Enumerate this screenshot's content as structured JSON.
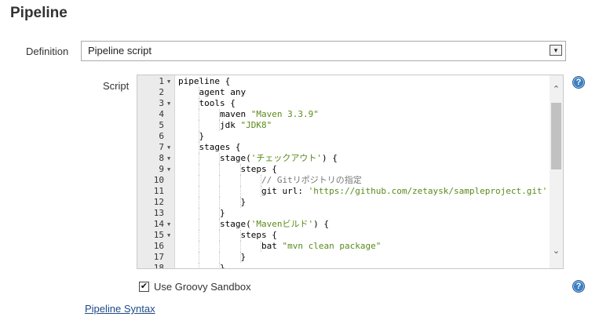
{
  "section": {
    "title": "Pipeline"
  },
  "definition": {
    "label": "Definition",
    "selected": "Pipeline script",
    "arrow": "▾"
  },
  "script": {
    "label": "Script",
    "lines": [
      {
        "n": "1",
        "fold": true,
        "indent": 0,
        "parts": [
          {
            "t": "pipeline {",
            "c": "kw"
          }
        ]
      },
      {
        "n": "2",
        "fold": false,
        "indent": 1,
        "parts": [
          {
            "t": "agent any",
            "c": "kw"
          }
        ]
      },
      {
        "n": "3",
        "fold": true,
        "indent": 1,
        "parts": [
          {
            "t": "tools {",
            "c": "kw"
          }
        ]
      },
      {
        "n": "4",
        "fold": false,
        "indent": 2,
        "parts": [
          {
            "t": "maven ",
            "c": "kw"
          },
          {
            "t": "\"Maven 3.3.9\"",
            "c": "str"
          }
        ]
      },
      {
        "n": "5",
        "fold": false,
        "indent": 2,
        "parts": [
          {
            "t": "jdk ",
            "c": "kw"
          },
          {
            "t": "\"JDK8\"",
            "c": "str"
          }
        ]
      },
      {
        "n": "6",
        "fold": false,
        "indent": 1,
        "parts": [
          {
            "t": "}",
            "c": "kw"
          }
        ]
      },
      {
        "n": "7",
        "fold": true,
        "indent": 1,
        "parts": [
          {
            "t": "stages {",
            "c": "kw"
          }
        ]
      },
      {
        "n": "8",
        "fold": true,
        "indent": 2,
        "parts": [
          {
            "t": "stage(",
            "c": "kw"
          },
          {
            "t": "'チェックアウト'",
            "c": "str"
          },
          {
            "t": ") {",
            "c": "kw"
          }
        ]
      },
      {
        "n": "9",
        "fold": true,
        "indent": 3,
        "parts": [
          {
            "t": "steps {",
            "c": "kw"
          }
        ]
      },
      {
        "n": "10",
        "fold": false,
        "indent": 4,
        "parts": [
          {
            "t": "// Gitリポジトリの指定",
            "c": "cm"
          }
        ]
      },
      {
        "n": "11",
        "fold": false,
        "indent": 4,
        "parts": [
          {
            "t": "git url: ",
            "c": "kw"
          },
          {
            "t": "'https://github.com/zetaysk/sampleproject.git'",
            "c": "str"
          }
        ]
      },
      {
        "n": "12",
        "fold": false,
        "indent": 3,
        "parts": [
          {
            "t": "}",
            "c": "kw"
          }
        ]
      },
      {
        "n": "13",
        "fold": false,
        "indent": 2,
        "parts": [
          {
            "t": "}",
            "c": "kw"
          }
        ]
      },
      {
        "n": "14",
        "fold": true,
        "indent": 2,
        "parts": [
          {
            "t": "stage(",
            "c": "kw"
          },
          {
            "t": "'Mavenビルド'",
            "c": "str"
          },
          {
            "t": ") {",
            "c": "kw"
          }
        ]
      },
      {
        "n": "15",
        "fold": true,
        "indent": 3,
        "parts": [
          {
            "t": "steps {",
            "c": "kw"
          }
        ]
      },
      {
        "n": "16",
        "fold": false,
        "indent": 4,
        "parts": [
          {
            "t": "bat ",
            "c": "kw"
          },
          {
            "t": "\"mvn clean package\"",
            "c": "str"
          }
        ]
      },
      {
        "n": "17",
        "fold": false,
        "indent": 3,
        "parts": [
          {
            "t": "}",
            "c": "kw"
          }
        ]
      },
      {
        "n": "18",
        "fold": false,
        "indent": 2,
        "parts": [
          {
            "t": "}",
            "c": "kw"
          }
        ]
      }
    ]
  },
  "sandbox": {
    "label": "Use Groovy Sandbox",
    "checked": true,
    "check_glyph": "✔"
  },
  "links": {
    "pipeline_syntax": "Pipeline Syntax"
  },
  "help": {
    "glyph": "?"
  },
  "colors": {
    "string": "#5a8a1a",
    "comment": "#777777",
    "link": "#204a87",
    "help": "#3d7fc1"
  }
}
